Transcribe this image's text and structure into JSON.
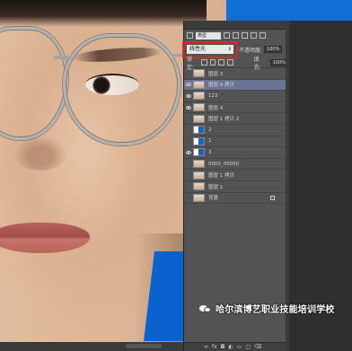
{
  "panel": {
    "filter_kind": "类型",
    "blend_mode": "线性光",
    "opacity_label": "不透明度:",
    "opacity_value": "100%",
    "lock_label": "锁定:",
    "fill_label": "填充:",
    "fill_value": "100%"
  },
  "layers": [
    {
      "name": "图层 3",
      "visible": false,
      "thumb": "photo"
    },
    {
      "name": "图层 4 拷贝",
      "visible": true,
      "thumb": "photo",
      "selected": true
    },
    {
      "name": "123",
      "visible": true,
      "thumb": "photo"
    },
    {
      "name": "图层 4",
      "visible": true,
      "thumb": "photo"
    },
    {
      "name": "图层 1 拷贝 2",
      "visible": false,
      "thumb": "photo"
    },
    {
      "name": "2",
      "visible": false,
      "thumb": "blue"
    },
    {
      "name": "1",
      "visible": false,
      "thumb": "blue"
    },
    {
      "name": "3",
      "visible": true,
      "thumb": "blue"
    },
    {
      "name": "0000_00000",
      "visible": false,
      "thumb": "photo"
    },
    {
      "name": "图层 1 拷贝",
      "visible": false,
      "thumb": "photo"
    },
    {
      "name": "图层 1",
      "visible": false,
      "thumb": "photo"
    },
    {
      "name": "背景",
      "visible": false,
      "thumb": "photo",
      "locked": true
    }
  ],
  "footer_icons": [
    "link-icon",
    "fx-icon",
    "mask-icon",
    "adjustment-icon",
    "group-icon",
    "new-layer-icon",
    "trash-icon"
  ],
  "watermark": {
    "text": "哈尔滨博艺职业技能培训学校"
  },
  "colors": {
    "panel_bg": "#535353",
    "selected_layer": "#6b7593",
    "highlight_red": "#e0262a",
    "blue_bg": "#0f6fd6"
  }
}
